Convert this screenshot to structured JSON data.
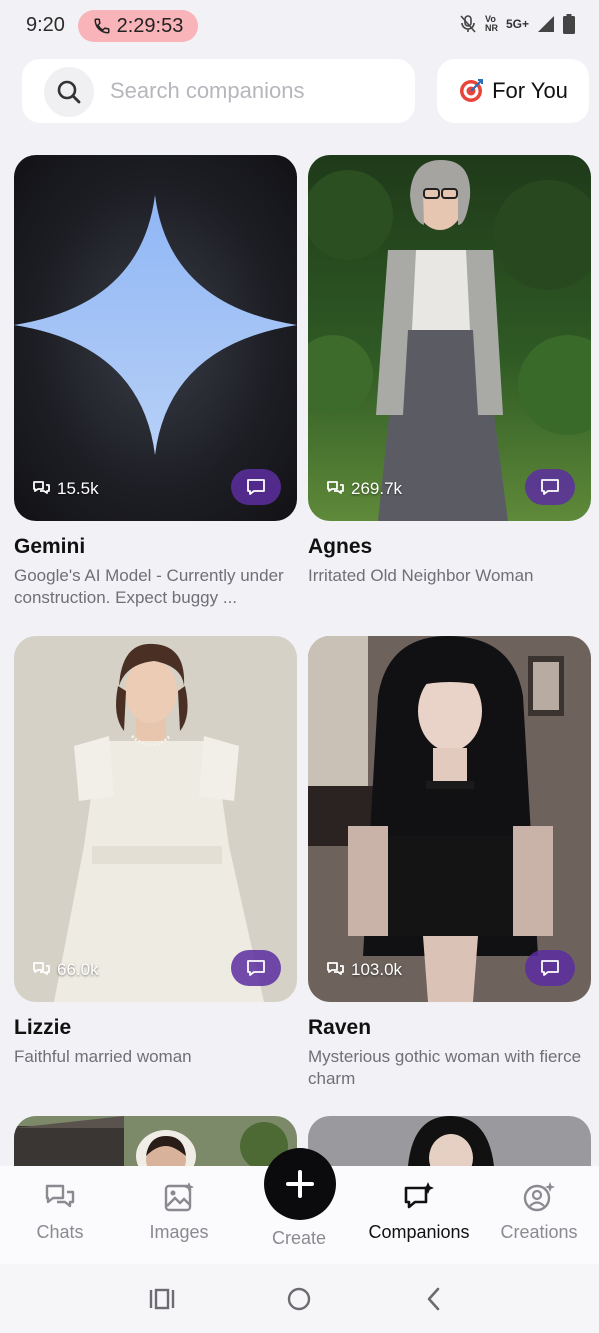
{
  "status_bar": {
    "time": "9:20",
    "call_timer": "2:29:53",
    "network_top": "Vo",
    "network_bottom": "NR",
    "network_5g": "5G+",
    "call_pill_color": "#f8b4b8"
  },
  "search": {
    "placeholder": "Search companions",
    "value": ""
  },
  "filter": {
    "label": "For You",
    "icon": "target-icon"
  },
  "companions": [
    {
      "name": "Gemini",
      "description": "Google's AI Model - Currently under construction. Expect buggy ...",
      "chat_count": "15.5k"
    },
    {
      "name": "Agnes",
      "description": "Irritated Old Neighbor Woman",
      "chat_count": "269.7k"
    },
    {
      "name": "Lizzie",
      "description": "Faithful married woman",
      "chat_count": "66.0k"
    },
    {
      "name": "Raven",
      "description": "Mysterious gothic woman with fierce charm",
      "chat_count": "103.0k"
    }
  ],
  "bottom_nav": {
    "items": [
      {
        "label": "Chats",
        "icon": "chats-icon"
      },
      {
        "label": "Images",
        "icon": "images-icon"
      },
      {
        "label": "Create",
        "icon": "plus-icon"
      },
      {
        "label": "Companions",
        "icon": "companions-icon",
        "active": true
      },
      {
        "label": "Creations",
        "icon": "creations-icon"
      }
    ]
  },
  "colors": {
    "accent_purple": "#5c2ea0",
    "background": "#f2f2f6"
  }
}
